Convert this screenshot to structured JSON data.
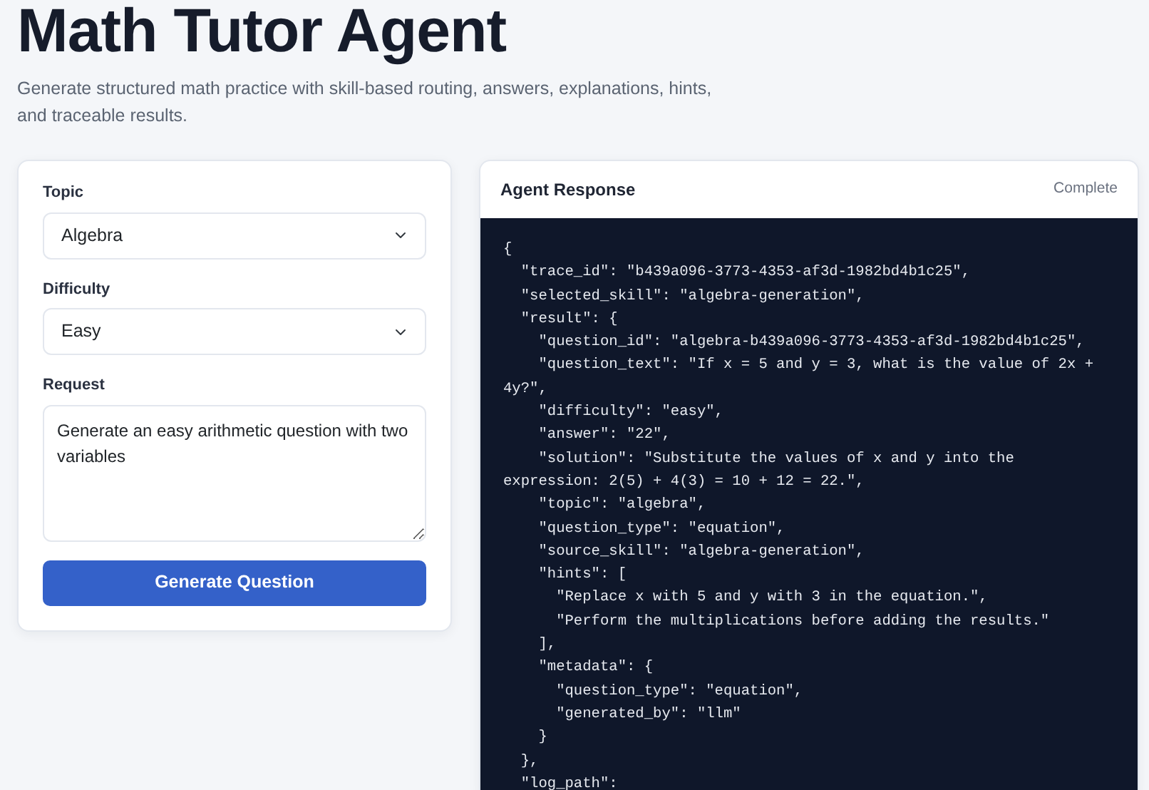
{
  "header": {
    "title": "Math Tutor Agent",
    "subtitle": "Generate structured math practice with skill-based routing, answers, explanations, hints, and traceable results."
  },
  "form": {
    "fields": [
      {
        "kind": "select",
        "label": "Topic",
        "value": "Algebra"
      },
      {
        "kind": "select",
        "label": "Difficulty",
        "value": "Easy"
      },
      {
        "kind": "textarea",
        "label": "Request",
        "value": "Generate an easy arithmetic question with two variables"
      }
    ],
    "button": "Generate Question"
  },
  "response": {
    "title": "Agent Response",
    "status": "Complete",
    "lines": [
      "{",
      "  \"trace_id\": \"b439a096-3773-4353-af3d-1982bd4b1c25\",",
      "  \"selected_skill\": \"algebra-generation\",",
      "  \"result\": {",
      "    \"question_id\": \"algebra-b439a096-3773-4353-af3d-1982bd4b1c25\",",
      "    \"question_text\": \"If x = 5 and y = 3, what is the value of 2x +",
      "4y?\",",
      "    \"difficulty\": \"easy\",",
      "    \"answer\": \"22\",",
      "    \"solution\": \"Substitute the values of x and y into the",
      "expression: 2(5) + 4(3) = 10 + 12 = 22.\",",
      "    \"topic\": \"algebra\",",
      "    \"question_type\": \"equation\",",
      "    \"source_skill\": \"algebra-generation\",",
      "    \"hints\": [",
      "      \"Replace x with 5 and y with 3 in the equation.\",",
      "      \"Perform the multiplications before adding the results.\"",
      "    ],",
      "    \"metadata\": {",
      "      \"question_type\": \"equation\",",
      "      \"generated_by\": \"llm\"",
      "    }",
      "  },",
      "  \"log_path\":"
    ]
  }
}
